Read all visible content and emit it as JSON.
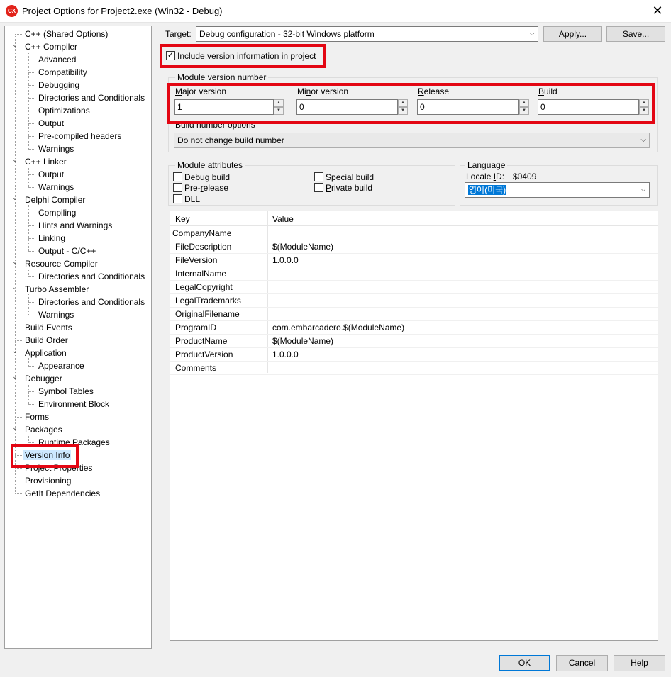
{
  "window": {
    "title": "Project Options for Project2.exe  (Win32 - Debug)",
    "icon_label": "CX",
    "close_glyph": "✕"
  },
  "tree": {
    "items": [
      {
        "label": "C++ (Shared Options)",
        "level": 0,
        "expanded": null,
        "selected": false
      },
      {
        "label": "C++ Compiler",
        "level": 0,
        "expanded": true,
        "selected": false
      },
      {
        "label": "Advanced",
        "level": 1,
        "expanded": null,
        "selected": false
      },
      {
        "label": "Compatibility",
        "level": 1,
        "expanded": null,
        "selected": false
      },
      {
        "label": "Debugging",
        "level": 1,
        "expanded": null,
        "selected": false
      },
      {
        "label": "Directories and Conditionals",
        "level": 1,
        "expanded": null,
        "selected": false
      },
      {
        "label": "Optimizations",
        "level": 1,
        "expanded": null,
        "selected": false
      },
      {
        "label": "Output",
        "level": 1,
        "expanded": null,
        "selected": false
      },
      {
        "label": "Pre-compiled headers",
        "level": 1,
        "expanded": null,
        "selected": false
      },
      {
        "label": "Warnings",
        "level": 1,
        "expanded": null,
        "selected": false
      },
      {
        "label": "C++ Linker",
        "level": 0,
        "expanded": true,
        "selected": false
      },
      {
        "label": "Output",
        "level": 1,
        "expanded": null,
        "selected": false
      },
      {
        "label": "Warnings",
        "level": 1,
        "expanded": null,
        "selected": false
      },
      {
        "label": "Delphi Compiler",
        "level": 0,
        "expanded": true,
        "selected": false
      },
      {
        "label": "Compiling",
        "level": 1,
        "expanded": null,
        "selected": false
      },
      {
        "label": "Hints and Warnings",
        "level": 1,
        "expanded": null,
        "selected": false
      },
      {
        "label": "Linking",
        "level": 1,
        "expanded": null,
        "selected": false
      },
      {
        "label": "Output - C/C++",
        "level": 1,
        "expanded": null,
        "selected": false
      },
      {
        "label": "Resource Compiler",
        "level": 0,
        "expanded": true,
        "selected": false
      },
      {
        "label": "Directories and Conditionals",
        "level": 1,
        "expanded": null,
        "selected": false
      },
      {
        "label": "Turbo Assembler",
        "level": 0,
        "expanded": true,
        "selected": false
      },
      {
        "label": "Directories and Conditionals",
        "level": 1,
        "expanded": null,
        "selected": false
      },
      {
        "label": "Warnings",
        "level": 1,
        "expanded": null,
        "selected": false
      },
      {
        "label": "Build Events",
        "level": 0,
        "expanded": null,
        "selected": false
      },
      {
        "label": "Build Order",
        "level": 0,
        "expanded": null,
        "selected": false
      },
      {
        "label": "Application",
        "level": 0,
        "expanded": true,
        "selected": false
      },
      {
        "label": "Appearance",
        "level": 1,
        "expanded": null,
        "selected": false
      },
      {
        "label": "Debugger",
        "level": 0,
        "expanded": true,
        "selected": false
      },
      {
        "label": "Symbol Tables",
        "level": 1,
        "expanded": null,
        "selected": false
      },
      {
        "label": "Environment Block",
        "level": 1,
        "expanded": null,
        "selected": false
      },
      {
        "label": "Forms",
        "level": 0,
        "expanded": null,
        "selected": false
      },
      {
        "label": "Packages",
        "level": 0,
        "expanded": true,
        "selected": false
      },
      {
        "label": "Runtime Packages",
        "level": 1,
        "expanded": null,
        "selected": false
      },
      {
        "label": "Version Info",
        "level": 0,
        "expanded": null,
        "selected": true
      },
      {
        "label": "Project Properties",
        "level": 0,
        "expanded": null,
        "selected": false
      },
      {
        "label": "Provisioning",
        "level": 0,
        "expanded": null,
        "selected": false
      },
      {
        "label": "GetIt Dependencies",
        "level": 0,
        "expanded": null,
        "selected": false
      }
    ]
  },
  "target": {
    "label_accel": "T",
    "label_rest": "arget:",
    "value": "Debug configuration - 32-bit Windows platform",
    "apply_accel": "A",
    "apply_rest": "pply...",
    "save_accel": "S",
    "save_rest": "ave..."
  },
  "include_version": {
    "checked": true,
    "label_pre": "Include ",
    "label_accel": "v",
    "label_post": "ersion information in project"
  },
  "module_version": {
    "title": "Module version number",
    "fields": [
      {
        "label_accel": "M",
        "label_rest": "ajor version",
        "value": "1"
      },
      {
        "label_pre": "Mi",
        "label_accel": "n",
        "label_rest": "or version",
        "value": "0"
      },
      {
        "label_accel": "R",
        "label_rest": "elease",
        "value": "0"
      },
      {
        "label_accel": "B",
        "label_rest": "uild",
        "value": "0"
      }
    ],
    "build_options_label": "Build number options",
    "build_options_value": "Do not change build number"
  },
  "module_attributes": {
    "title": "Module attributes",
    "items": [
      {
        "pre": "",
        "accel": "D",
        "post": "ebug build",
        "checked": false
      },
      {
        "pre": "Pre-",
        "accel": "r",
        "post": "elease",
        "checked": false
      },
      {
        "pre": "D",
        "accel": "L",
        "post": "L",
        "checked": false
      },
      {
        "pre": "",
        "accel": "S",
        "post": "pecial build",
        "checked": false
      },
      {
        "pre": "",
        "accel": "P",
        "post": "rivate build",
        "checked": false
      }
    ]
  },
  "language": {
    "title": "Language",
    "locale_label_pre": "Locale ",
    "locale_label_accel": "I",
    "locale_label_post": "D:",
    "locale_id": "$0409",
    "value": "영어(미국)"
  },
  "kv_table": {
    "headers": [
      "Key",
      "Value"
    ],
    "rows": [
      {
        "key": "CompanyName",
        "value": ""
      },
      {
        "key": "FileDescription",
        "value": "$(ModuleName)"
      },
      {
        "key": "FileVersion",
        "value": "1.0.0.0"
      },
      {
        "key": "InternalName",
        "value": ""
      },
      {
        "key": "LegalCopyright",
        "value": ""
      },
      {
        "key": "LegalTrademarks",
        "value": ""
      },
      {
        "key": "OriginalFilename",
        "value": ""
      },
      {
        "key": "ProgramID",
        "value": "com.embarcadero.$(ModuleName)"
      },
      {
        "key": "ProductName",
        "value": "$(ModuleName)"
      },
      {
        "key": "ProductVersion",
        "value": "1.0.0.0"
      },
      {
        "key": "Comments",
        "value": ""
      }
    ]
  },
  "footer": {
    "ok": "OK",
    "cancel": "Cancel",
    "help": "Help"
  },
  "colors": {
    "highlight_box": "#e30613",
    "selection": "#cce8ff",
    "language_selection": "#0078d7"
  },
  "glyphs": {
    "chevron_down": "⌄",
    "dropdown_arrow": "⌵",
    "spin_up": "▲",
    "spin_down": "▼",
    "check": "✓"
  }
}
